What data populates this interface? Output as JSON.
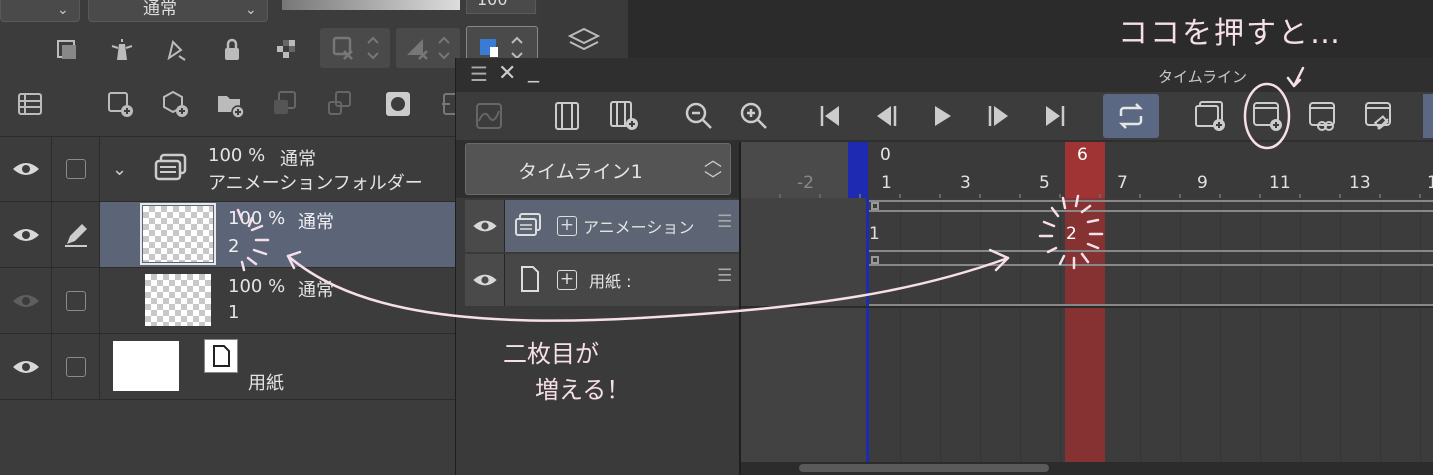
{
  "layer_panel": {
    "blend_mode": "通常",
    "opacity_partial": "100",
    "layers": [
      {
        "opacity": "100 %",
        "mode": "通常",
        "name": "アニメーションフォルダー"
      },
      {
        "opacity": "100 %",
        "mode": "通常",
        "name": "2"
      },
      {
        "opacity": "100 %",
        "mode": "通常",
        "name": "1"
      },
      {
        "name": "用紙"
      }
    ]
  },
  "timeline": {
    "window_title": "タイムライン",
    "name": "タイムライン1",
    "ruler_numbers": [
      "-2",
      "1",
      "3",
      "5",
      "7",
      "9",
      "11",
      "13",
      "1"
    ],
    "frame_top_zero": "0",
    "frame_top_current": "6",
    "tracks": [
      {
        "name": "アニメーションフ",
        "cel_marker_1": "1",
        "cel_marker_2": "2"
      },
      {
        "name": "用紙 :"
      }
    ]
  },
  "annotations": {
    "press_here": "ココを押すと…",
    "second_added_1": "二枚目が",
    "second_added_2": "増える！"
  },
  "colors": {
    "playhead": "#1f2ab3",
    "current_frame": "#a03434",
    "annotation": "#f6dfe6",
    "selected_row": "#5c6478"
  }
}
